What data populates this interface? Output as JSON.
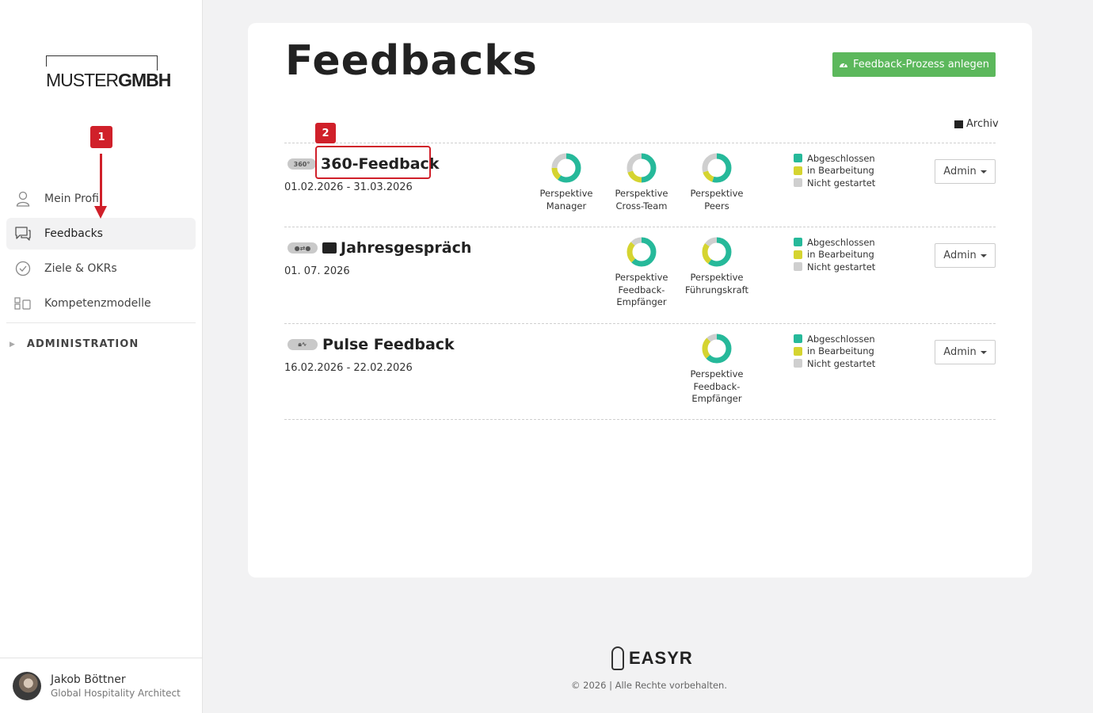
{
  "sidebar": {
    "logo": {
      "part1": "MUSTER",
      "part2": "GMBH"
    },
    "items": [
      {
        "label": "Mein Profil",
        "icon": "user-icon",
        "active": false
      },
      {
        "label": "Feedbacks",
        "icon": "chat-icon",
        "active": true
      },
      {
        "label": "Ziele & OKRs",
        "icon": "check-circle-icon",
        "active": false
      },
      {
        "label": "Kompetenzmodelle",
        "icon": "grid-icon",
        "active": false
      }
    ],
    "admin_label": "ADMINISTRATION",
    "user": {
      "name": "Jakob Böttner",
      "role": "Global Hospitality Architect"
    }
  },
  "annotations": {
    "marker1": "1",
    "marker2": "2"
  },
  "main": {
    "title": "Feedbacks",
    "create_button": "Feedback-Prozess anlegen",
    "archive_link": "Archiv",
    "legend": {
      "done": "Abgeschlossen",
      "in_progress": "in Bearbeitung",
      "not_started": "Nicht gestartet"
    },
    "admin_button": "Admin",
    "processes": [
      {
        "name": "360-Feedback",
        "badge": "360°",
        "date": "01.02.2026 - 31.03.2026",
        "perspectives": [
          {
            "label": [
              "Perspektive",
              "Manager"
            ],
            "done": 0.6,
            "in_progress": 0.15,
            "not_started": 0.25
          },
          {
            "label": [
              "Perspektive",
              "Cross-Team"
            ],
            "done": 0.5,
            "in_progress": 0.2,
            "not_started": 0.3
          },
          {
            "label": [
              "Perspektive",
              "Peers"
            ],
            "done": 0.55,
            "in_progress": 0.15,
            "not_started": 0.3
          }
        ]
      },
      {
        "name": "Jahresgespräch",
        "badge": "",
        "date": "01. 07. 2026",
        "perspectives": [
          {
            "label": [
              "Perspektive",
              "Feedback-",
              "Empfänger"
            ],
            "done": 0.62,
            "in_progress": 0.25,
            "not_started": 0.13
          },
          {
            "label": [
              "Perspektive",
              "Führungskraft"
            ],
            "done": 0.6,
            "in_progress": 0.25,
            "not_started": 0.15
          }
        ]
      },
      {
        "name": "Pulse Feedback",
        "badge": "",
        "date": "16.02.2026 - 22.02.2026",
        "perspectives": [
          {
            "label": [
              "Perspektive",
              "Feedback-",
              "Empfänger"
            ],
            "done": 0.63,
            "in_progress": 0.25,
            "not_started": 0.12
          }
        ]
      }
    ]
  },
  "footer": {
    "brand": "EASYR",
    "copyright": "© 2026 | Alle Rechte vorbehalten."
  },
  "colors": {
    "done": "#26b99a",
    "in_progress": "#d5d430",
    "not_started": "#cfcfcf",
    "primary_button": "#5cb85c",
    "annotation": "#d0202a"
  }
}
